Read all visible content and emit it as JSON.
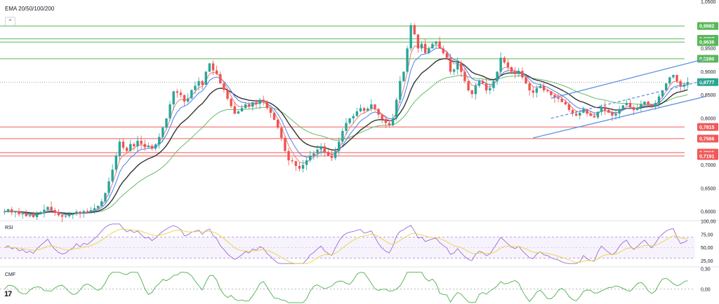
{
  "legend": {
    "indicator_label": "EMA 20/50/100/200",
    "collapse_glyph": "^"
  },
  "panes": {
    "rsi_label": "RSI",
    "cmf_label": "CMF"
  },
  "logo": "17",
  "colors": {
    "up": "#26a69a",
    "down": "#ef5350",
    "ema20": "#f07a7a",
    "ema50": "#4c7cf0",
    "ema100": "#333333",
    "ema200": "#66bb6a",
    "support": "#f05a5a",
    "resistance": "#58b758",
    "channel": "#5a8fe6",
    "rsi": "#9c6bd6",
    "rsi_ma": "#e6d63a",
    "cmf": "#4caf50"
  },
  "chart_data": {
    "type": "candlestick",
    "price_axis": {
      "ticks": [
        "1,0500",
        "0,9500",
        "0,9000",
        "0,8500",
        "0,8000",
        "0,7000",
        "0,6500",
        "0,6000"
      ],
      "ylim": [
        0.585,
        1.051
      ]
    },
    "levels": [
      {
        "value": "0,9982",
        "price": 0.9982,
        "kind": "resistance"
      },
      {
        "value": "0,9707",
        "price": 0.9707,
        "kind": "resistance"
      },
      {
        "value": "0,9636",
        "price": 0.9636,
        "kind": "resistance"
      },
      {
        "value": "0,9280",
        "price": 0.928,
        "kind": "resistance"
      },
      {
        "value": "0,7815",
        "price": 0.7815,
        "kind": "support"
      },
      {
        "value": "0,7566",
        "price": 0.7566,
        "kind": "support"
      },
      {
        "value": "0,7265",
        "price": 0.7265,
        "kind": "support"
      },
      {
        "value": "0,7191",
        "price": 0.7191,
        "kind": "support"
      }
    ],
    "last_price": {
      "value": "0,8777",
      "price": 0.8777
    },
    "channel": {
      "upper": [
        [
          152,
          0.843
        ],
        [
          195,
          0.928
        ]
      ],
      "lower": [
        [
          147,
          0.758
        ],
        [
          195,
          0.847
        ]
      ],
      "mid": [
        [
          152,
          0.8
        ],
        [
          195,
          0.882
        ]
      ]
    },
    "closes": [
      0.6,
      0.605,
      0.598,
      0.601,
      0.594,
      0.596,
      0.59,
      0.592,
      0.588,
      0.594,
      0.599,
      0.604,
      0.61,
      0.603,
      0.597,
      0.592,
      0.589,
      0.59,
      0.593,
      0.595,
      0.6,
      0.597,
      0.601,
      0.6,
      0.603,
      0.607,
      0.612,
      0.622,
      0.64,
      0.665,
      0.69,
      0.72,
      0.75,
      0.737,
      0.73,
      0.745,
      0.74,
      0.752,
      0.745,
      0.738,
      0.741,
      0.735,
      0.744,
      0.76,
      0.78,
      0.8,
      0.83,
      0.858,
      0.855,
      0.85,
      0.836,
      0.843,
      0.861,
      0.87,
      0.88,
      0.872,
      0.9,
      0.918,
      0.903,
      0.895,
      0.875,
      0.861,
      0.842,
      0.826,
      0.81,
      0.815,
      0.822,
      0.83,
      0.825,
      0.835,
      0.831,
      0.84,
      0.836,
      0.822,
      0.812,
      0.797,
      0.78,
      0.758,
      0.73,
      0.71,
      0.708,
      0.698,
      0.692,
      0.7,
      0.71,
      0.72,
      0.725,
      0.733,
      0.74,
      0.728,
      0.72,
      0.715,
      0.73,
      0.75,
      0.773,
      0.79,
      0.8,
      0.805,
      0.815,
      0.822,
      0.816,
      0.821,
      0.83,
      0.82,
      0.808,
      0.798,
      0.79,
      0.785,
      0.8,
      0.84,
      0.88,
      0.9,
      0.95,
      1.0,
      0.98,
      0.95,
      0.96,
      0.94,
      0.95,
      0.96,
      0.965,
      0.95,
      0.94,
      0.93,
      0.9,
      0.905,
      0.92,
      0.9,
      0.88,
      0.86,
      0.852,
      0.87,
      0.88,
      0.875,
      0.86,
      0.865,
      0.88,
      0.9,
      0.93,
      0.92,
      0.91,
      0.9,
      0.895,
      0.902,
      0.888,
      0.875,
      0.86,
      0.855,
      0.865,
      0.87,
      0.86,
      0.858,
      0.85,
      0.845,
      0.842,
      0.835,
      0.83,
      0.818,
      0.81,
      0.806,
      0.812,
      0.82,
      0.81,
      0.805,
      0.802,
      0.814,
      0.825,
      0.818,
      0.812,
      0.806,
      0.81,
      0.82,
      0.828,
      0.833,
      0.824,
      0.818,
      0.823,
      0.83,
      0.836,
      0.83,
      0.825,
      0.833,
      0.847,
      0.86,
      0.875,
      0.888,
      0.893,
      0.88,
      0.868,
      0.872,
      0.8777
    ],
    "rsi_axis": {
      "ticks": [
        "100,00",
        "75,00",
        "50,00",
        "25,00"
      ],
      "ylim": [
        15,
        100
      ],
      "bands": [
        30,
        70
      ]
    },
    "cmf_axis": {
      "ticks": [
        "0,30",
        "0,00"
      ],
      "ylim": [
        -0.22,
        0.32
      ]
    }
  }
}
